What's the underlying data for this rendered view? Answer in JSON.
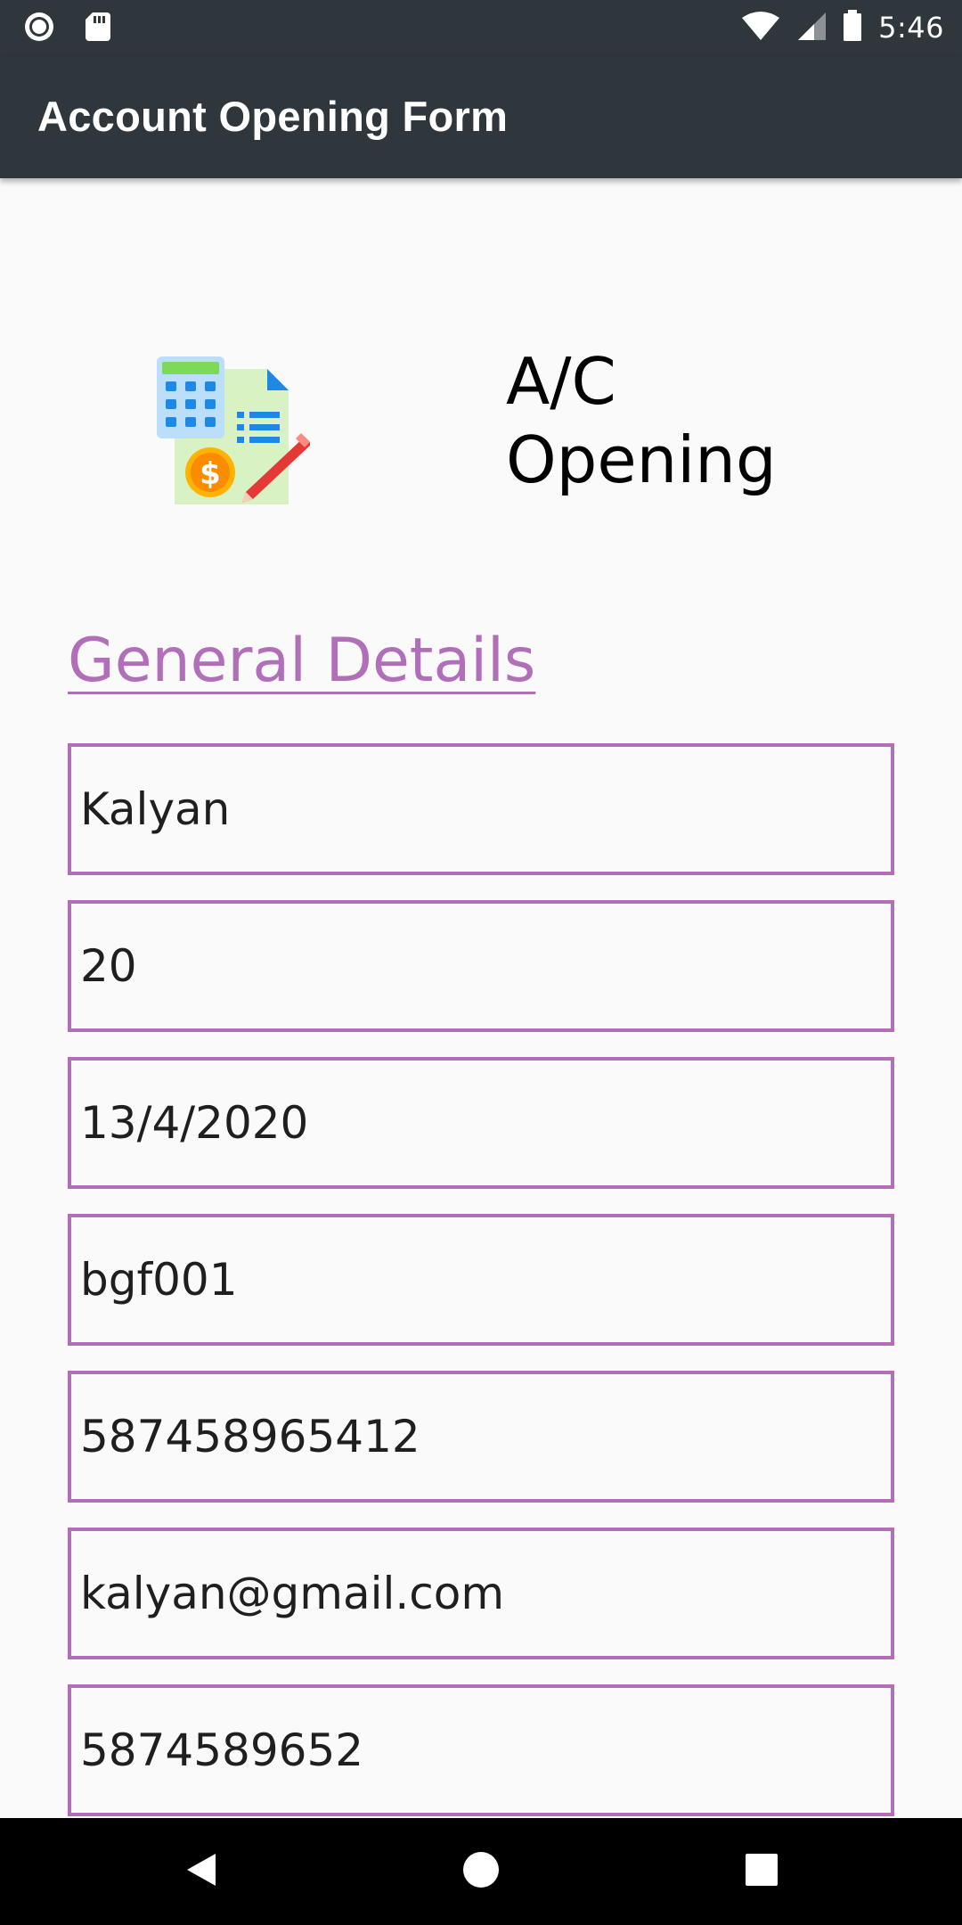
{
  "status_bar": {
    "time": "5:46",
    "left_icons": [
      "record-icon",
      "sd-card-icon"
    ],
    "right_icons": [
      "wifi-icon",
      "signal-icon",
      "battery-icon"
    ]
  },
  "app_bar": {
    "title": "Account Opening Form"
  },
  "hero": {
    "icon": "calculator-document-icon",
    "title": "A/C\nOpening"
  },
  "section": {
    "title": "General Details"
  },
  "fields": [
    {
      "value": "Kalyan"
    },
    {
      "value": "20"
    },
    {
      "value": "13/4/2020"
    },
    {
      "value": "bgf001"
    },
    {
      "value": "587458965412"
    },
    {
      "value": "kalyan@gmail.com"
    },
    {
      "value": "5874589652"
    }
  ],
  "nav_bar": {
    "buttons": [
      "back-icon",
      "home-icon",
      "recents-icon"
    ]
  },
  "colors": {
    "bar": "#2f363c",
    "accent": "#b26fb9",
    "background": "#fafafa"
  }
}
